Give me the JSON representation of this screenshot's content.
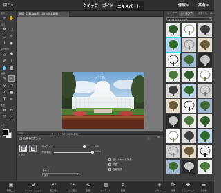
{
  "topbar": {
    "open_label": "開く",
    "tabs": [
      "クイック",
      "ガイド",
      "エキスパート"
    ],
    "create_label": "作成",
    "share_label": "共有"
  },
  "document": {
    "tab_title": "IMG_0341.jpg @ 100% (RGB/8)"
  },
  "tools": {
    "sections": [
      "表示",
      "選択",
      "画質調整",
      "描画",
      "変更",
      "カラー"
    ]
  },
  "statusbar": {
    "zoom": "100%",
    "file_info": "ファイル : 364.5K/364.5K"
  },
  "options": {
    "title": "自動選択ブラシ",
    "brush_caption": "ブラシ",
    "size_label": "サイズ：",
    "size_value": "100",
    "size_percent": 0.8,
    "opacity_label": "不透明度：",
    "opacity_value": "100%",
    "opacity_percent": 1.0,
    "mode_label": "モード：",
    "mode_value": "通常",
    "check_all_layers": "全レイヤーを対象",
    "check_normal": "調整",
    "check_auto_enhance": "自動強調",
    "check_states": {
      "all_layers": false,
      "normal": true,
      "auto_enhance": true
    }
  },
  "rightpanel": {
    "tabs": [
      "レイヤー",
      "フィルター",
      "スタイル"
    ],
    "filter_category": "すべてのフィルター",
    "thumb_count": 30
  },
  "bottombar": {
    "buttons": [
      {
        "icon": "photo-bin-icon",
        "label": "写真ビン"
      },
      {
        "icon": "tool-options-icon",
        "label": "ツールオプション"
      },
      {
        "icon": "undo-icon",
        "label": "取り消し"
      },
      {
        "icon": "redo-icon",
        "label": "やり直し"
      },
      {
        "icon": "rotate-icon",
        "label": "回転"
      },
      {
        "icon": "layout-icon",
        "label": "レイアウト"
      },
      {
        "icon": "organizer-icon",
        "label": "整理"
      },
      {
        "icon": "layers-icon",
        "label": "レイヤー"
      },
      {
        "icon": "effects-icon",
        "label": "効果"
      },
      {
        "icon": "graphics-icon",
        "label": "グラフィック"
      },
      {
        "icon": "more-icon",
        "label": "その他"
      }
    ]
  },
  "colors": {
    "accent": "#3ad0ff",
    "panel": "#3d3d3d",
    "canvas": "#7a7a7a"
  }
}
